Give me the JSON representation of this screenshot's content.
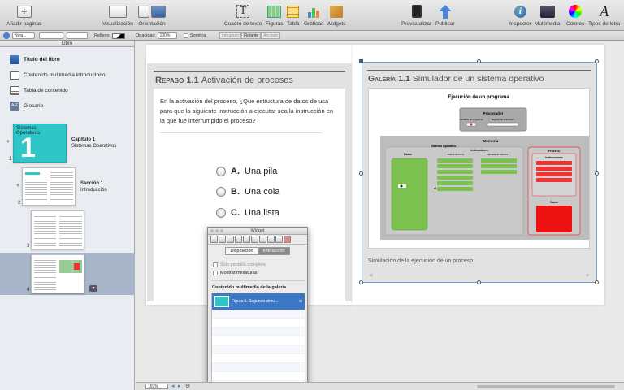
{
  "toolbar": {
    "add_pages": "Añadir páginas",
    "view": "Visualización",
    "orientation": "Orientación",
    "textbox": "Cuadro de texto",
    "shapes": "Figuras",
    "table": "Tabla",
    "charts": "Gráficas",
    "widgets": "Widgets",
    "preview": "Previsualizar",
    "publish": "Publicar",
    "inspector": "Inspector",
    "media": "Multimedia",
    "colors": "Colores",
    "fonts": "Tipos de letra"
  },
  "formatbar": {
    "style_value": "Ning...",
    "fill_label": "Relleno",
    "opacity_label": "Opacidad",
    "opacity_value": "100%",
    "shadow_label": "Sombra",
    "wrap_inline": "Integrado",
    "wrap_float": "Flotante",
    "wrap_anchored": "Anclado"
  },
  "sidebar": {
    "header": "Libro",
    "items": [
      {
        "label": "Título del libro"
      },
      {
        "label": "Contenido multimedia introductorio"
      },
      {
        "label": "Tabla de contenido"
      },
      {
        "label": "Glosario"
      }
    ],
    "thumb_cover_title": "Sistemas Operativos",
    "thumb_cover_big": "1",
    "chapter_label": "Capítulo 1",
    "chapter_title": "Sistemas Operativos",
    "section_label": "Sección 1",
    "section_title": "Introducción",
    "pages": [
      "1",
      "2",
      "3",
      "4"
    ]
  },
  "review": {
    "kind": "Repaso 1.1",
    "title": "Activación de procesos",
    "question": "En la activación del proceso, ¿Qué estructura de datos de usa para que la siguiente instrucción a ejecutar sea la instrucción en la que fue interrumpido el proceso?",
    "answers": [
      {
        "letter": "A.",
        "text": "Una pila"
      },
      {
        "letter": "B.",
        "text": "Una cola"
      },
      {
        "letter": "C.",
        "text": "Una lista"
      }
    ]
  },
  "gallery": {
    "kind": "Galería 1.1",
    "title": "Simulador de un sistema operativo",
    "caption": "Simulación de la ejecución de un proceso",
    "diagram": {
      "title": "Ejecución de un programa",
      "processor": "Procesador",
      "pc": "Contador de Programa",
      "ir": "Registro de instrucción",
      "memory": "Memoria",
      "os": "Sistema Operativo",
      "instructions": "Instrucciones",
      "routine": "Rutina de Inicio",
      "syscall": "Llamada al sistema",
      "data": "Datos",
      "process": "Proceso",
      "p_instructions": "Instrucciones",
      "p_data": "Datos"
    }
  },
  "widget": {
    "title": "Widget",
    "tab_layout": "Disposición",
    "tab_interaction": "Interacción",
    "opt_fullscreen": "Solo pantalla completa",
    "opt_thumbnails": "Mostrar miniaturas",
    "section": "Contenido multimedia de la galería",
    "item": "Figura 5. Segundo simu..."
  },
  "statusbar": {
    "zoom": "107%"
  }
}
